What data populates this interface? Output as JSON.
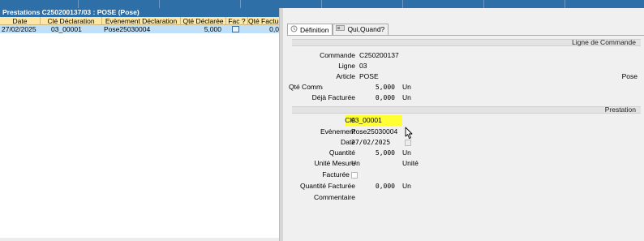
{
  "window": {
    "title": "Prestations C250200137/03 : POSE (Pose)"
  },
  "grid": {
    "headers": [
      "Date",
      "Clé Déclaration",
      "Evènement Déclaration",
      "Qté Déclarée",
      "Fac ?",
      "Qté Factur"
    ],
    "rows": [
      {
        "date": "27/02/2025",
        "cle": "03_00001",
        "evenement": "Pose25030004",
        "qte_declaree": "5,000",
        "fac": false,
        "qte_facturee": "0,0"
      }
    ]
  },
  "tabs": [
    {
      "label": "Définition",
      "icon": "definition-icon",
      "active": true
    },
    {
      "label": "Qui,Quand?",
      "icon": "who-when-icon",
      "active": false
    }
  ],
  "ligne_commande": {
    "section_title": "Ligne de Commande",
    "commande_label": "Commande",
    "commande": "C250200137",
    "ligne_label": "Ligne",
    "ligne": "03",
    "article_label": "Article",
    "article": "POSE",
    "article_desc": "Pose",
    "qte_commandee_label": "Qté Commandé",
    "qte_commandee": "5,000",
    "qte_commandee_unit": "Un",
    "deja_facturee_label": "Déjà Facturée",
    "deja_facturee": "0,000",
    "deja_facturee_unit": "Un"
  },
  "prestation": {
    "section_title": "Prestation",
    "cle_label": "Clé",
    "cle": "03_00001",
    "evenement_label": "Evènement",
    "evenement": "Pose25030004",
    "date_label": "Date",
    "date": "27/02/2025",
    "quantite_label": "Quantité",
    "quantite": "5,000",
    "quantite_unit": "Un",
    "unite_mesure_label": "Unité Mesure",
    "unite_mesure": "Un",
    "unite_mesure_desc": "Unité",
    "facturee_label": "Facturée ?",
    "facturee": false,
    "quantite_facturee_label": "Quantité Facturée",
    "quantite_facturee": "0,000",
    "quantite_facturee_unit": "Un",
    "commentaire_label": "Commentaire"
  },
  "colors": {
    "title_bar": "#2f6fa8",
    "grid_header": "#ffe7a3",
    "selected_row": "#bfe0f8",
    "highlight": "#ffff33"
  }
}
